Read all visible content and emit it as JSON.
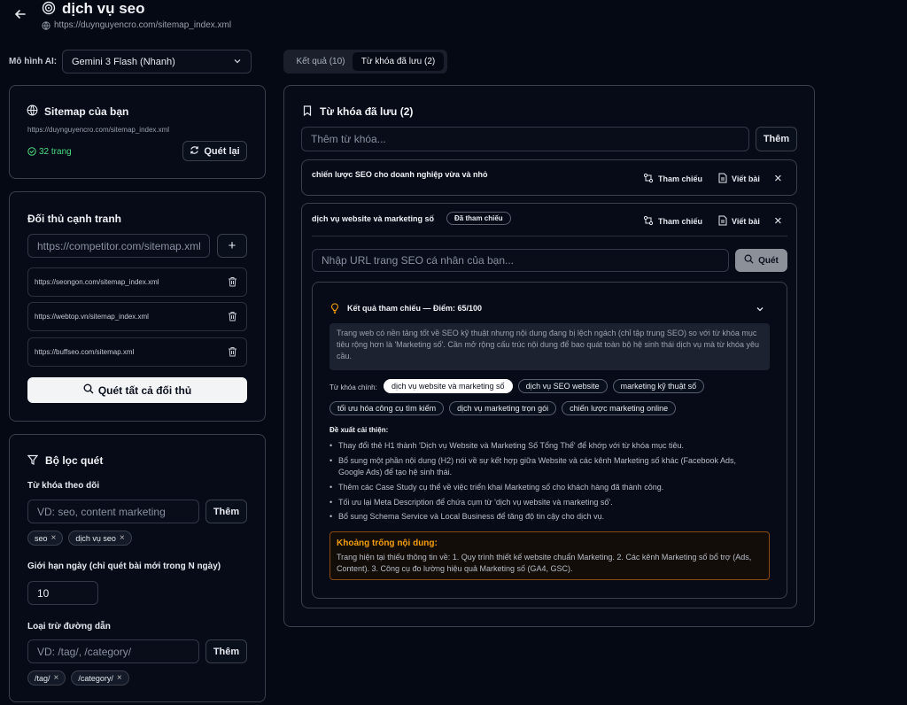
{
  "header": {
    "title": "dịch vụ seo",
    "url": "https://duynguyencro.com/sitemap_index.xml"
  },
  "model": {
    "label": "Mô hình AI:",
    "selected": "Gemini 3 Flash (Nhanh)"
  },
  "tabs": [
    {
      "label": "Kết quả (10)",
      "active": false
    },
    {
      "label": "Từ khóa đã lưu (2)",
      "active": true
    }
  ],
  "sitemap": {
    "title": "Sitemap của bạn",
    "url": "https://duynguyencro.com/sitemap_index.xml",
    "pages": "32 trang",
    "rescan_label": "Quét lại"
  },
  "competitors": {
    "title": "Đối thủ cạnh tranh",
    "input_placeholder": "https://competitor.com/sitemap.xml",
    "add_label": "+",
    "items": [
      "https://seongon.com/sitemap_index.xml",
      "https://webtop.vn/sitemap_index.xml",
      "https://buffseo.com/sitemap.xml"
    ],
    "scan_all_label": "Quét tất cả đối thủ"
  },
  "filters": {
    "title": "Bộ lọc quét",
    "keywords_label": "Từ khóa theo dõi",
    "keywords_placeholder": "VD: seo, content marketing",
    "keywords_add": "Thêm",
    "keywords_tags": [
      "seo",
      "dịch vụ seo"
    ],
    "days_label": "Giới hạn ngày (chỉ quét bài mới trong N ngày)",
    "days_value": "10",
    "exclude_label": "Loại trừ đường dẫn",
    "exclude_placeholder": "VD: /tag/, /category/",
    "exclude_add": "Thêm",
    "exclude_tags": [
      "/tag/",
      "/category/"
    ]
  },
  "saved": {
    "title": "Từ khóa đã lưu (2)",
    "input_placeholder": "Thêm từ khóa...",
    "add_label": "Thêm",
    "reference_label": "Tham chiếu",
    "write_label": "Viết bài",
    "rows": [
      {
        "keyword": "chiến lược SEO cho doanh nghiệp vừa và nhỏ"
      },
      {
        "keyword": "dịch vụ website và marketing số",
        "badge": "Đã tham chiếu"
      }
    ],
    "url_placeholder": "Nhập URL trang SEO cá nhân của bạn...",
    "scan_label": "Quét"
  },
  "result": {
    "title": "Kết quả tham chiếu — Điểm: 65/100",
    "summary": "Trang web có nền tảng tốt về SEO kỹ thuật nhưng nội dung đang bị lệch ngách (chỉ tập trung SEO) so với từ khóa mục tiêu rộng hơn là 'Marketing số'. Cần mở rộng cấu trúc nội dung để bao quát toàn bộ hệ sinh thái dịch vụ mà từ khóa yêu cầu.",
    "main_kw_label": "Từ khóa chính:",
    "main_kws": [
      "dịch vụ website và marketing số",
      "dịch vụ SEO website",
      "marketing kỹ thuật số",
      "tối ưu hóa công cụ tìm kiếm",
      "dịch vụ marketing trọn gói",
      "chiến lược marketing online"
    ],
    "suggestions_title": "Đề xuất cải thiện:",
    "suggestions": [
      "Thay đổi thẻ H1 thành 'Dịch vụ Website và Marketing Số Tổng Thể' để khớp với từ khóa mục tiêu.",
      "Bổ sung một phần nội dung (H2) nói về sự kết hợp giữa Website và các kênh Marketing số khác (Facebook Ads, Google Ads) để tạo hệ sinh thái.",
      "Thêm các Case Study cụ thể về việc triển khai Marketing số cho khách hàng đã thành công.",
      "Tối ưu lại Meta Description để chứa cụm từ 'dịch vụ website và marketing số'.",
      "Bổ sung Schema Service và Local Business để tăng độ tin cậy cho dịch vụ."
    ],
    "gap_title": "Khoảng trống nội dung:",
    "gap_text": "Trang hiện tại thiếu thông tin về: 1. Quy trình thiết kế website chuẩn Marketing. 2. Các kênh Marketing số bổ trợ (Ads, Content). 3. Công cụ đo lường hiệu quả Marketing số (GA4, GSC)."
  },
  "colors": {
    "background": "#050914",
    "accent_green": "#4ade80",
    "accent_orange": "#f59e0b"
  }
}
